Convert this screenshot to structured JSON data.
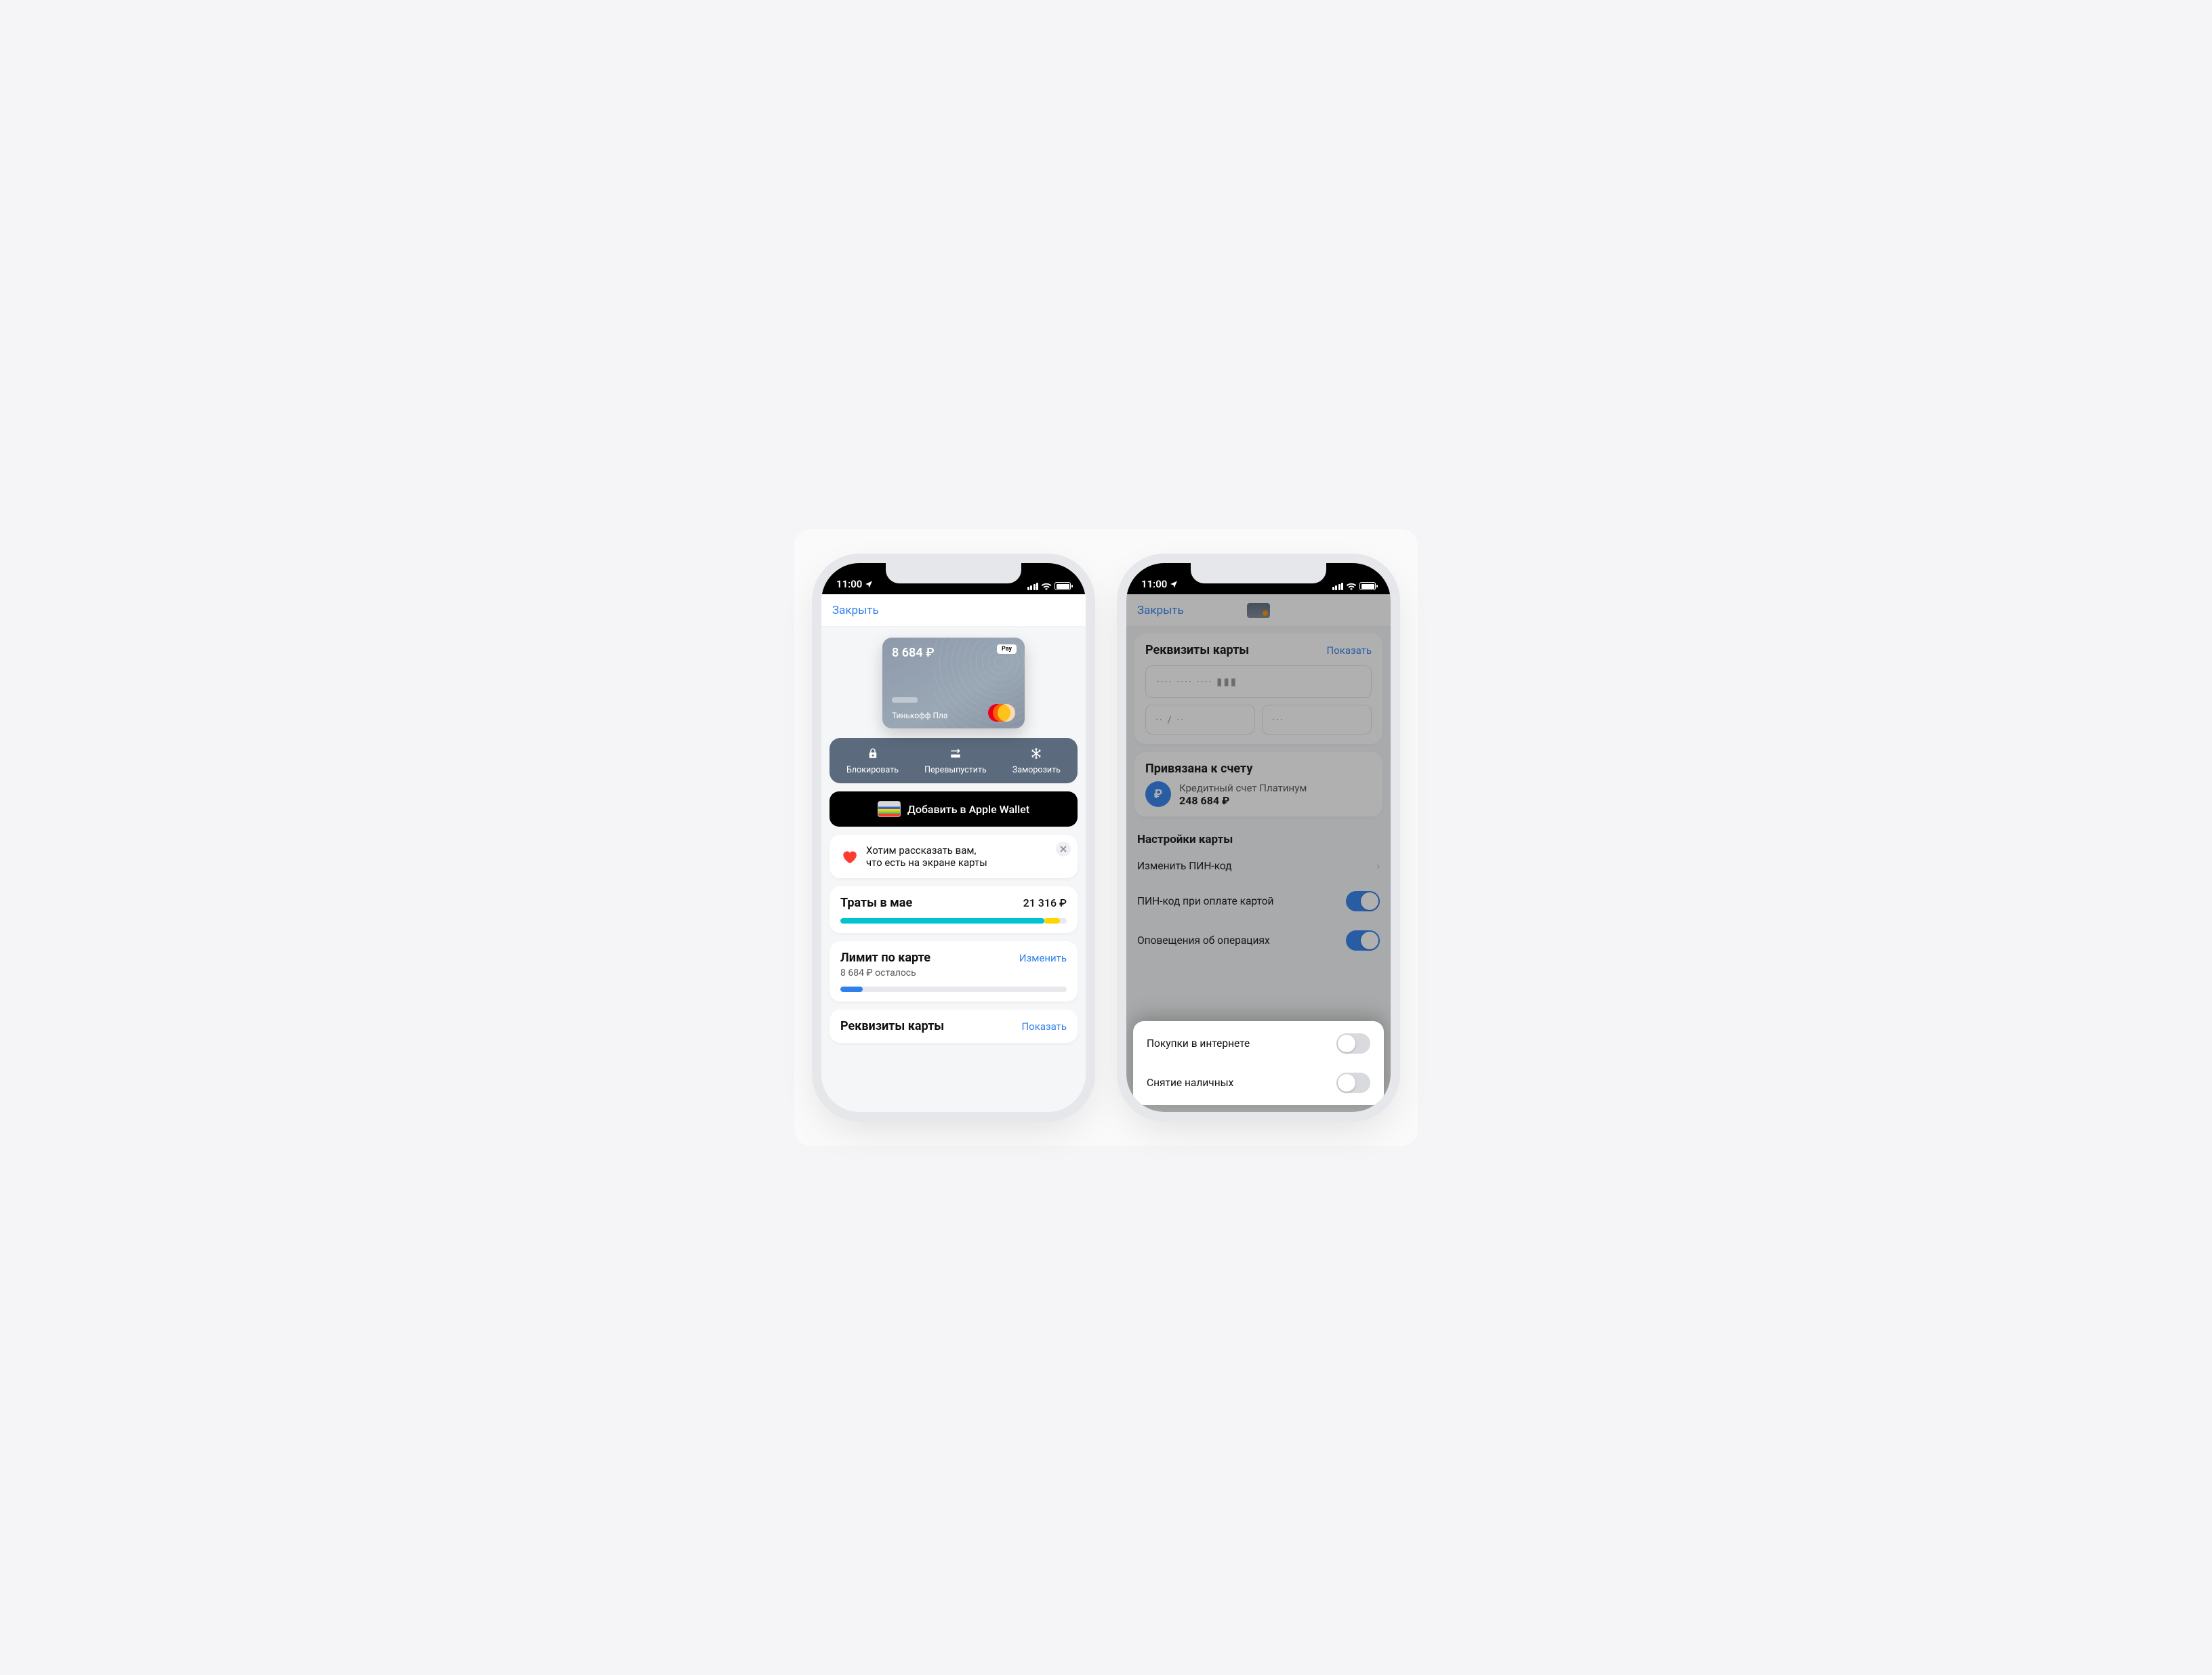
{
  "status": {
    "time": "11:00"
  },
  "phone1": {
    "close": "Закрыть",
    "card": {
      "balance": "8 684 ₽",
      "brand": "Тинькофф Пла",
      "apple_pay_badge": "Pay"
    },
    "actions": {
      "block": "Блокировать",
      "reissue": "Перевыпустить",
      "freeze": "Заморозить"
    },
    "wallet_button": "Добавить в Apple Wallet",
    "info": {
      "line1": "Хотим рассказать вам,",
      "line2": "что есть на экране карты"
    },
    "spend": {
      "title": "Траты в мае",
      "amount": "21 316 ₽"
    },
    "limit": {
      "title": "Лимит по карте",
      "change": "Изменить",
      "remaining": "8 684 ₽ осталось"
    },
    "requisites": {
      "title": "Реквизиты карты",
      "show": "Показать"
    }
  },
  "phone2": {
    "close": "Закрыть",
    "requisites": {
      "title": "Реквизиты карты",
      "show": "Показать",
      "pan": "···· ···· ···· ▮▮▮",
      "exp": "·· / ··",
      "cvv": "···"
    },
    "linked": {
      "title": "Привязана к счету",
      "ruble": "₽",
      "name": "Кредитный счет Платинум",
      "balance": "248 684 ₽"
    },
    "settings": {
      "title": "Настройки карты",
      "pin": "Изменить ПИН-код",
      "pin_on_pay": "ПИН-код при оплате картой",
      "tx_notify": "Оповещения об операциях",
      "online": "Покупки в интернете",
      "cash": "Снятие наличных"
    }
  }
}
